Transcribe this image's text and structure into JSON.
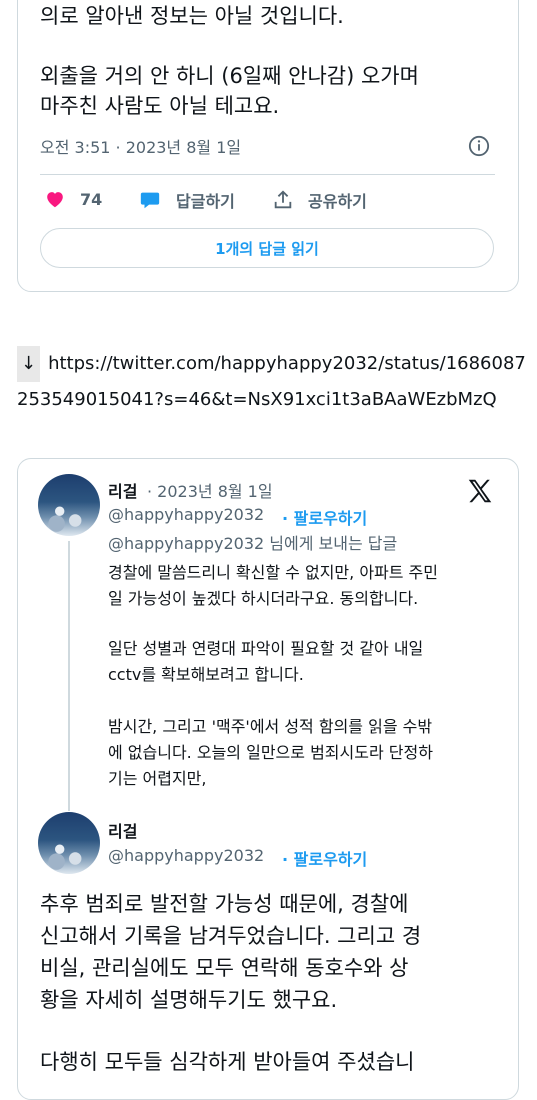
{
  "tweet1": {
    "lines": [
      "의로 알아낸 정보는 아닐 것입니다.",
      "외출을 거의 안 하니 (6일째 안나감) 오가며",
      "마주친 사람도 아닐 테고요."
    ],
    "timestamp": "오전 3:51 · 2023년 8월 1일",
    "like_count": "74",
    "reply_label": "답글하기",
    "share_label": "공유하기",
    "read_replies_label": "1개의 답글 읽기"
  },
  "link": {
    "arrow": "↓",
    "url": "https://twitter.com/happyhappy2032/status/1686087253549015041?s=46&t=NsX91xci1t3aBAaWEzbMzQ"
  },
  "embed": {
    "author_name": "리걸",
    "date": "· 2023년 8월 1일",
    "handle": "@happyhappy2032",
    "follow_label": "· 팔로우하기",
    "reply_to": "@happyhappy2032 님에게 보내는 답글",
    "reply_paragraphs": [
      [
        "경찰에 말씀드리니 확신할 수 없지만, 아파트 주민",
        "일 가능성이 높겠다 하시더라구요. 동의합니다."
      ],
      [
        "일단 성별과 연령대 파악이 필요할 것 같아 내일",
        "cctv를 확보해보려고 합니다."
      ],
      [
        "밤시간, 그리고 '맥주'에서 성적 함의를 읽을 수밖",
        "에 없습니다. 오늘의 일만으로 범죄시도라 단정하",
        "기는 어렵지만,"
      ]
    ],
    "second_author_name": "리걸",
    "second_handle": "@happyhappy2032",
    "second_follow_label": "· 팔로우하기",
    "main_lines": [
      "추후 범죄로 발전할 가능성 때문에, 경찰에",
      "신고해서 기록을 남겨두었습니다. 그리고 경",
      "비실, 관리실에도 모두 연락해 동호수와 상",
      "황을 자세히 설명해두기도 했구요.",
      "",
      "다행히 모두들 심각하게 받아들여 주셨습니"
    ]
  },
  "colors": {
    "accent": "#1d9bf0",
    "like": "#f91880",
    "muted": "#536471",
    "border": "#cfd9de"
  }
}
